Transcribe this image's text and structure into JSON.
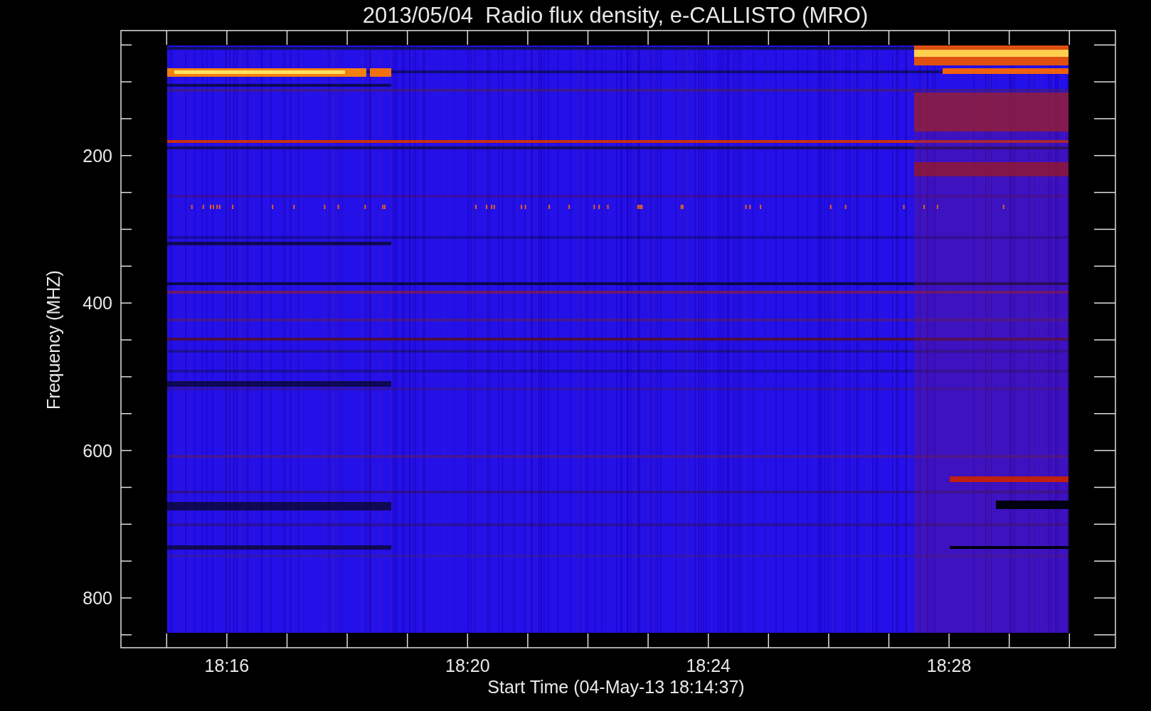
{
  "title": "2013/05/04  Radio flux density, e-CALLISTO (MRO)",
  "y_axis": {
    "label": "Frequency (MHZ)",
    "ticks": [
      "200",
      "400",
      "600",
      "800"
    ]
  },
  "x_axis": {
    "label": "Start Time (04-May-13 18:14:37)",
    "ticks": [
      "18:16",
      "18:20",
      "18:24",
      "18:28"
    ]
  }
}
